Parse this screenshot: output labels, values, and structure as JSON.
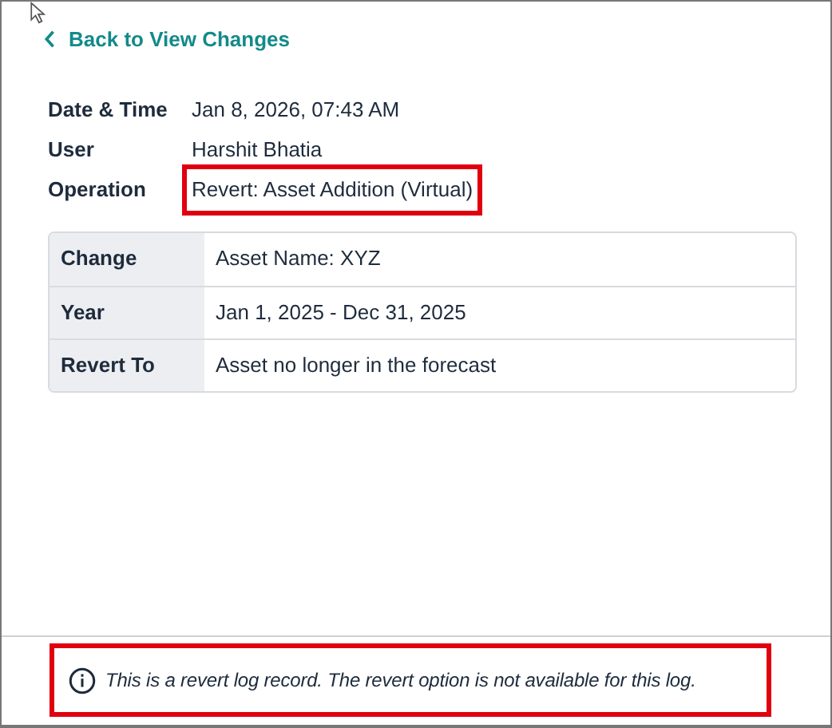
{
  "back_link": {
    "label": "Back to View Changes"
  },
  "details": [
    {
      "label": "Date & Time",
      "value": "Jan 8, 2026, 07:43 AM",
      "highlighted": false
    },
    {
      "label": "User",
      "value": "Harshit Bhatia",
      "highlighted": false
    },
    {
      "label": "Operation",
      "value": "Revert: Asset Addition (Virtual)",
      "highlighted": true
    }
  ],
  "change_table": {
    "rows": [
      {
        "label": "Change",
        "value": "Asset Name: XYZ"
      },
      {
        "label": "Year",
        "value": "Jan 1, 2025  - Dec 31, 2025"
      },
      {
        "label": "Revert To",
        "value": "Asset no longer in the forecast"
      }
    ]
  },
  "footer": {
    "message": "This is a revert log record. The revert option is not available for this log.",
    "highlighted": true
  }
}
